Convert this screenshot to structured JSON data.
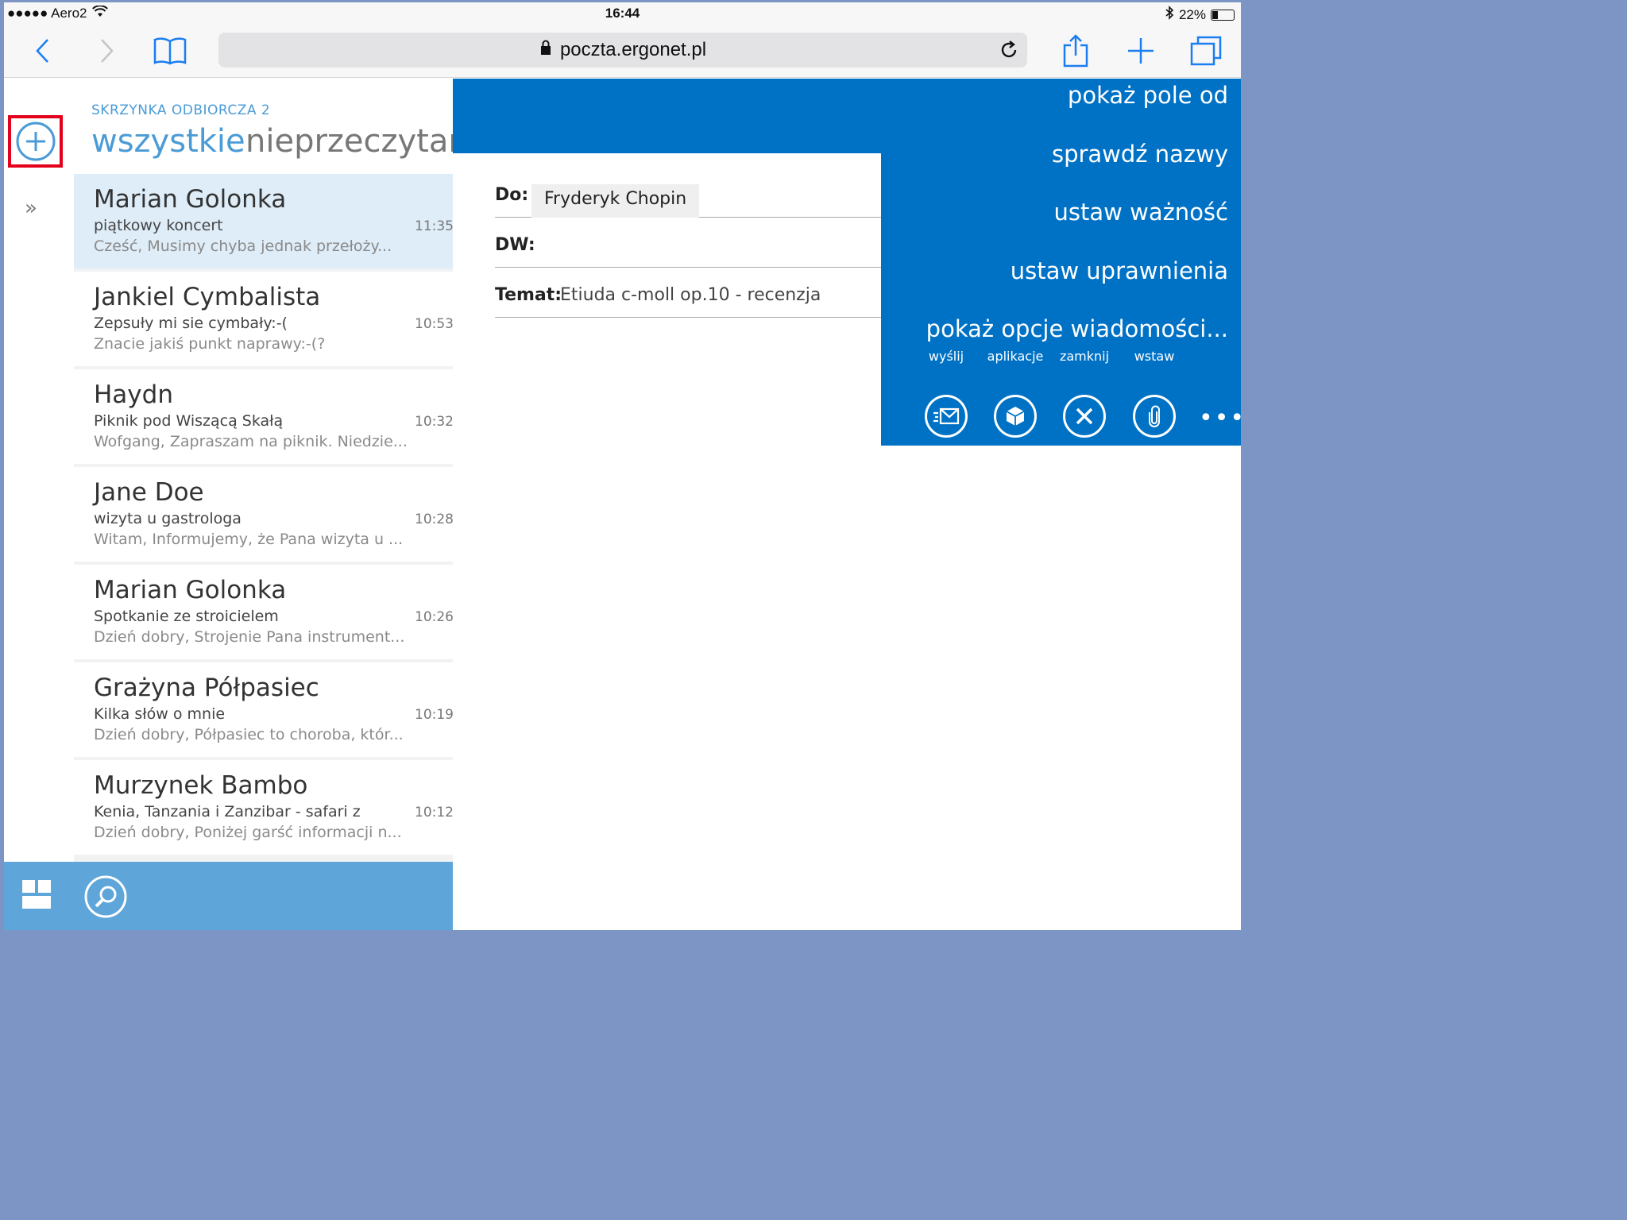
{
  "status_bar": {
    "carrier": "●●●●● Aero2",
    "time": "16:44",
    "battery": "22%"
  },
  "browser": {
    "url": "poczta.ergonet.pl"
  },
  "mail_list": {
    "folder": "SKRZYNKA ODBIORCZA  2",
    "filter_all": "wszystkie",
    "filter_unread": "nieprzeczytane",
    "items": [
      {
        "from": "Marian Golonka",
        "subject": "piątkowy koncert",
        "time": "11:35",
        "preview": "Cześć,    Musimy chyba jednak przełoży..."
      },
      {
        "from": "Jankiel Cymbalista",
        "subject": "Zepsuły mi sie cymbały:-(",
        "time": "10:53",
        "preview": "Znacie jakiś punkt naprawy:-(?"
      },
      {
        "from": "Haydn",
        "subject": "Piknik pod Wiszącą Skałą",
        "time": "10:32",
        "preview": "Wofgang,  Zapraszam na piknik. Niedzie..."
      },
      {
        "from": "Jane Doe",
        "subject": "wizyta u gastrologa",
        "time": "10:28",
        "preview": "Witam,  Informujemy, że Pana wizyta u ..."
      },
      {
        "from": "Marian Golonka",
        "subject": "Spotkanie ze stroicielem",
        "time": "10:26",
        "preview": "Dzień dobry,   Strojenie Pana instrument..."
      },
      {
        "from": "Grażyna Półpasiec",
        "subject": "Kilka słów o mnie",
        "time": "10:19",
        "preview": "Dzień dobry,  Półpasiec to choroba, któr..."
      },
      {
        "from": "Murzynek Bambo",
        "subject": "Kenia, Tanzania i Zanzibar - safari z",
        "time": "10:12",
        "preview": "Dzień dobry,  Poniżej garść informacji n..."
      }
    ]
  },
  "compose": {
    "to_label": "Do:",
    "to_value": "Fryderyk Chopin",
    "cc_label": "DW:",
    "subject_label": "Temat:",
    "subject_value": "Etiuda c-moll op.10 - recenzja"
  },
  "menu": {
    "items": [
      "pokaż pole od",
      "sprawdź nazwy",
      "ustaw ważność",
      "ustaw uprawnienia",
      "pokaż opcje wiadomości..."
    ],
    "actions": {
      "send": "wyślij",
      "apps": "aplikacje",
      "close": "zamknij",
      "insert": "wstaw",
      "more": "•••"
    }
  },
  "colors": {
    "accent": "#0072c6",
    "light_accent": "#5ea5da",
    "highlight": "#e3001b"
  }
}
